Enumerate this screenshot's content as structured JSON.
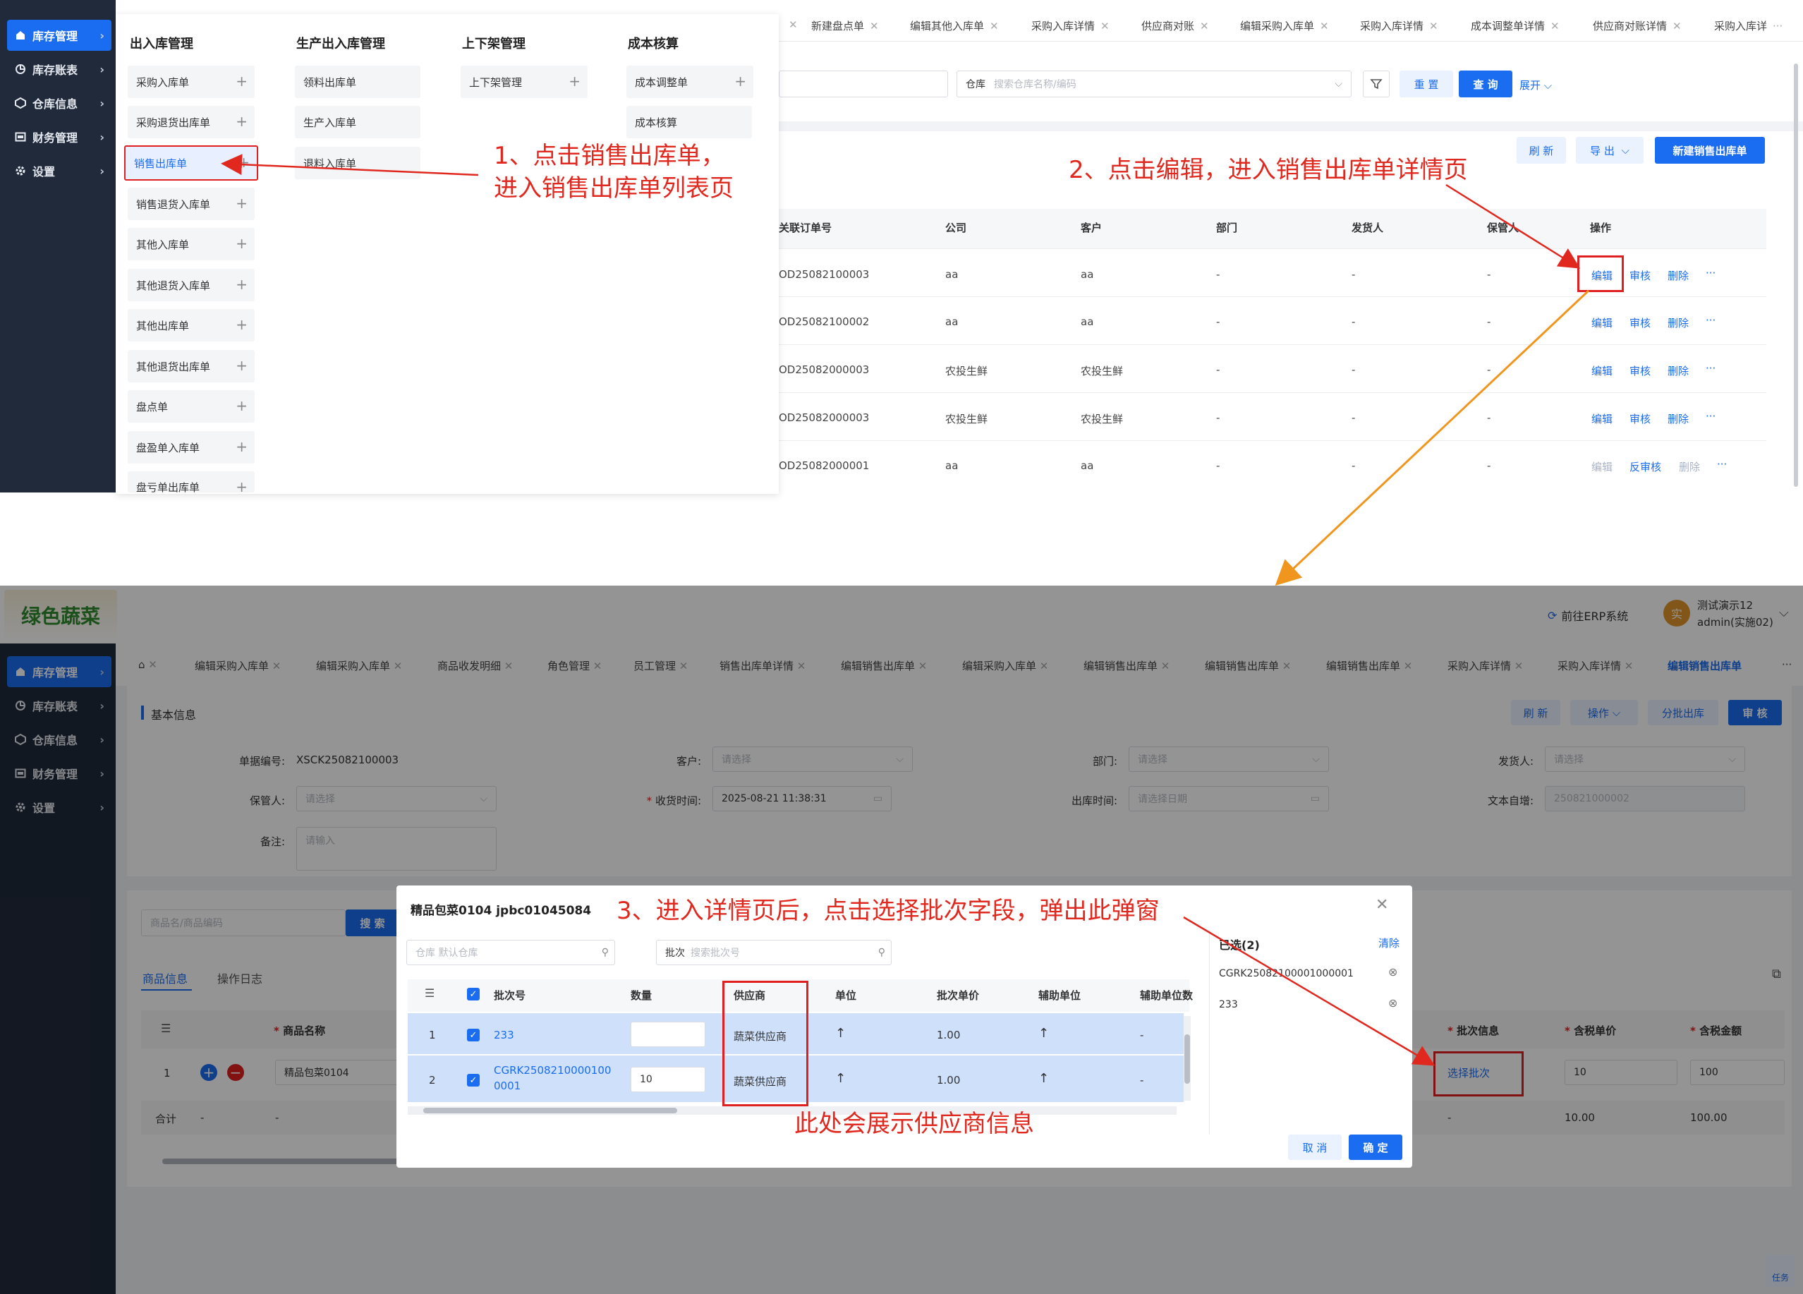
{
  "top": {
    "sidebar": [
      {
        "label": "库存管理",
        "icon": "home-icon",
        "active": true
      },
      {
        "label": "库存账表",
        "icon": "chart-pie-icon"
      },
      {
        "label": "仓库信息",
        "icon": "warehouse-icon"
      },
      {
        "label": "财务管理",
        "icon": "finance-icon"
      },
      {
        "label": "设置",
        "icon": "gear-icon"
      }
    ],
    "menu": {
      "col1": {
        "title": "出入库管理",
        "items": [
          "采购入库单",
          "采购退货出库单",
          "销售出库单",
          "销售退货入库单",
          "其他入库单",
          "其他退货入库单",
          "其他出库单",
          "其他退货出库单",
          "盘点单",
          "盘盈单入库单",
          "盘亏单出库单"
        ]
      },
      "col2": {
        "title": "生产出入库管理",
        "items": [
          "领料出库单",
          "生产入库单",
          "退料入库单"
        ]
      },
      "col3": {
        "title": "上下架管理",
        "items": [
          "上下架管理"
        ]
      },
      "col4": {
        "title": "成本核算",
        "items": [
          "成本调整单",
          "成本核算"
        ]
      }
    },
    "tabs": [
      "新建盘点单",
      "编辑其他入库单",
      "采购入库详情",
      "供应商对账",
      "编辑采购入库单",
      "采购入库详情",
      "成本调整单详情",
      "供应商对账详情",
      "采购入库详"
    ],
    "filter": {
      "warehouse_label": "仓库",
      "warehouse_placeholder": "搜索仓库名称/编码",
      "reset": "重 置",
      "query": "查 询",
      "expand": "展开"
    },
    "actions": {
      "refresh": "刷 新",
      "export": "导 出",
      "new": "新建销售出库单"
    },
    "columns": [
      "关联订单号",
      "公司",
      "客户",
      "部门",
      "发货人",
      "保管人",
      "操作"
    ],
    "rows": [
      {
        "order": "OD25082100003",
        "company": "aa",
        "customer": "aa",
        "dept": "-",
        "shipper": "-",
        "keeper": "-",
        "ops": [
          "编辑",
          "审核",
          "删除"
        ]
      },
      {
        "order": "OD25082100002",
        "company": "aa",
        "customer": "aa",
        "dept": "-",
        "shipper": "-",
        "keeper": "-",
        "ops": [
          "编辑",
          "审核",
          "删除"
        ]
      },
      {
        "order": "OD25082000003",
        "company": "农投生鲜",
        "customer": "农投生鲜",
        "dept": "-",
        "shipper": "-",
        "keeper": "-",
        "ops": [
          "编辑",
          "审核",
          "删除"
        ]
      },
      {
        "order": "OD25082000003",
        "company": "农投生鲜",
        "customer": "农投生鲜",
        "dept": "-",
        "shipper": "-",
        "keeper": "-",
        "ops": [
          "编辑",
          "审核",
          "删除"
        ]
      },
      {
        "order": "OD25082000001",
        "company": "aa",
        "customer": "aa",
        "dept": "-",
        "shipper": "-",
        "keeper": "-",
        "ops": [
          "编辑",
          "反审核",
          "删除"
        ]
      }
    ],
    "more": "···",
    "annotation1": [
      "1、点击销售出库单，",
      "进入销售出库单列表页"
    ],
    "annotation2": "2、点击编辑，进入销售出库单详情页"
  },
  "bottom": {
    "logo_text": "绿色蔬菜",
    "header": {
      "erp": "前往ERP系统",
      "user_name": "测试演示12",
      "user_account": "admin(实施02)",
      "avatar_char": "实"
    },
    "sidebar": [
      {
        "label": "库存管理",
        "icon": "home-icon",
        "active": true
      },
      {
        "label": "库存账表",
        "icon": "chart-pie-icon"
      },
      {
        "label": "仓库信息",
        "icon": "warehouse-icon"
      },
      {
        "label": "财务管理",
        "icon": "finance-icon"
      },
      {
        "label": "设置",
        "icon": "gear-icon"
      }
    ],
    "tabs": [
      "编辑采购入库单",
      "编辑采购入库单",
      "商品收发明细",
      "角色管理",
      "员工管理",
      "销售出库单详情",
      "编辑销售出库单",
      "编辑采购入库单",
      "编辑销售出库单",
      "编辑销售出库单",
      "编辑销售出库单",
      "采购入库详情",
      "采购入库详情",
      "编辑销售出库单"
    ],
    "section_title": "基本信息",
    "top_actions": {
      "refresh": "刷 新",
      "operate": "操作",
      "split": "分批出库",
      "audit": "审 核"
    },
    "form": {
      "doc_no_label": "单据编号:",
      "doc_no": "XSCK25082100003",
      "customer_label": "客户:",
      "customer_ph": "请选择",
      "dept_label": "部门:",
      "dept_ph": "请选择",
      "shipper_label": "发货人:",
      "shipper_ph": "请选择",
      "keeper_label": "保管人:",
      "keeper_ph": "请选择",
      "recv_label": "收货时间:",
      "recv_value": "2025-08-21 11:38:31",
      "out_label": "出库时间:",
      "out_ph": "请选择日期",
      "text_label": "文本自增:",
      "text_value": "250821000002",
      "remark_label": "备注:",
      "remark_ph": "请输入"
    },
    "search": {
      "placeholder": "商品名/商品编码",
      "button": "搜 索"
    },
    "subtabs": [
      "商品信息",
      "操作日志"
    ],
    "goods_cols": {
      "name": "商品名称",
      "batch": "批次信息",
      "price": "含税单价",
      "amount": "含税金额"
    },
    "goods_row": {
      "index": "1",
      "name": "精品包菜0104",
      "batch_btn": "选择批次",
      "price": "10",
      "amount": "100"
    },
    "total": {
      "label": "合计",
      "dash1": "-",
      "dash2": "-",
      "dash3": "-",
      "price": "10.00",
      "amount": "100.00"
    },
    "task": "任务"
  },
  "modal": {
    "title": "精品包菜0104 jpbc01045084",
    "warehouse_ph": "仓库 默认仓库",
    "batch_label": "批次",
    "batch_ph": "搜索批次号",
    "columns": [
      "批次号",
      "数量",
      "供应商",
      "单位",
      "批次单价",
      "辅助单位",
      "辅助单位数"
    ],
    "rows": [
      {
        "index": "1",
        "batch": "233",
        "qty": "",
        "supplier": "蔬菜供应商",
        "price": "1.00",
        "aux": "-"
      },
      {
        "index": "2",
        "batch": "CGRK25082100001000001",
        "batch_l1": "CGRK2508210000100",
        "batch_l2": "0001",
        "qty": "10",
        "supplier": "蔬菜供应商",
        "price": "1.00",
        "aux": "-"
      }
    ],
    "selected_title": "已选(2)",
    "clear": "清除",
    "selected": [
      "CGRK25082100001000001",
      "233"
    ],
    "cancel": "取 消",
    "confirm": "确 定"
  },
  "annotation3": "3、进入详情页后，点击选择批次字段，弹出此弹窗",
  "annotation4": "此处会展示供应商信息",
  "colors": {
    "primary": "#1a6cf0",
    "sidebar": "#202a3b",
    "annotation": "#e0281f",
    "arrow_orange": "#f0961e"
  }
}
